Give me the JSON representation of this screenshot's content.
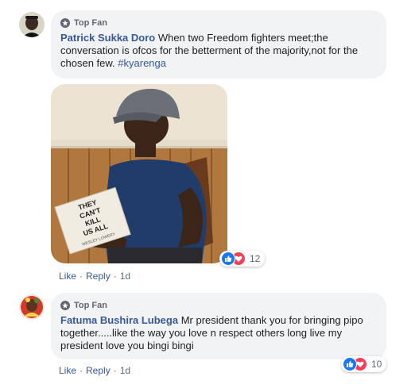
{
  "comments": [
    {
      "badge": "Top Fan",
      "author": "Patrick Sukka Doro",
      "text": " When two Freedom fighters meet;the conversation is ofcos for the betterment of the majority,not for the chosen few. ",
      "hashtag": "#kyarenga",
      "photo": {
        "book_title_lines": [
          "THEY",
          "CAN'T",
          "KILL",
          "US ALL"
        ],
        "book_author": "WESLEY LOWERY"
      },
      "reactions": {
        "icons": [
          "like-icon",
          "love-icon"
        ],
        "count": "12"
      },
      "actions": {
        "like": "Like",
        "reply": "Reply",
        "sep": "·",
        "time": "1d"
      }
    },
    {
      "badge": "Top Fan",
      "author": "Fatuma Bushira Lubega",
      "text": " Mr president thank you for bringing pipo together.....like the way you love n respect others long live my president love you bingi bingi",
      "reactions": {
        "icons": [
          "like-icon",
          "love-icon"
        ],
        "count": "10"
      },
      "actions": {
        "like": "Like",
        "reply": "Reply",
        "sep": "·",
        "time": "1d"
      }
    }
  ],
  "colors": {
    "link": "#385898",
    "bubble": "#f2f3f5",
    "like": "#1877f2",
    "love": "#f33e58"
  }
}
